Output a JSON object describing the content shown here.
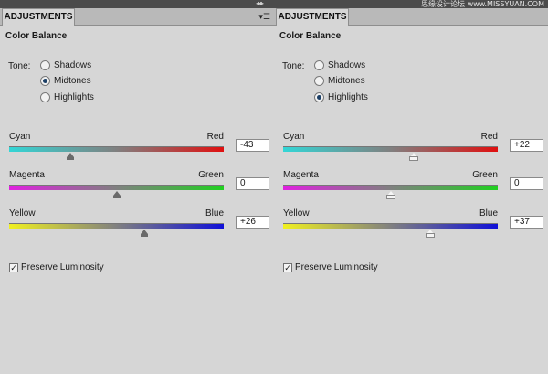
{
  "panels": [
    {
      "tab_label": "ADJUSTMENTS",
      "title": "Color Balance",
      "tone_label": "Tone:",
      "tones": [
        "Shadows",
        "Midtones",
        "Highlights"
      ],
      "selected_tone": "Midtones",
      "sliders": [
        {
          "left": "Cyan",
          "right": "Red",
          "value": "-43",
          "level": -43
        },
        {
          "left": "Magenta",
          "right": "Green",
          "value": "0",
          "level": 0
        },
        {
          "left": "Yellow",
          "right": "Blue",
          "value": "+26",
          "level": 26
        }
      ],
      "preserve_label": "Preserve Luminosity",
      "preserve_checked": true
    },
    {
      "tab_label": "ADJUSTMENTS",
      "title": "Color Balance",
      "tone_label": "Tone:",
      "tones": [
        "Shadows",
        "Midtones",
        "Highlights"
      ],
      "selected_tone": "Highlights",
      "sliders": [
        {
          "left": "Cyan",
          "right": "Red",
          "value": "+22",
          "level": 22
        },
        {
          "left": "Magenta",
          "right": "Green",
          "value": "0",
          "level": 0
        },
        {
          "left": "Yellow",
          "right": "Blue",
          "value": "+37",
          "level": 37
        }
      ],
      "preserve_label": "Preserve Luminosity",
      "preserve_checked": true
    }
  ],
  "watermark": "思缘设计论坛 www.MISSYUAN.COM",
  "colors": {
    "cyan": "#33d6d6",
    "red": "#e01010",
    "magenta": "#e020e0",
    "green": "#20d020",
    "yellow": "#f0f020",
    "blue": "#1010d8"
  }
}
